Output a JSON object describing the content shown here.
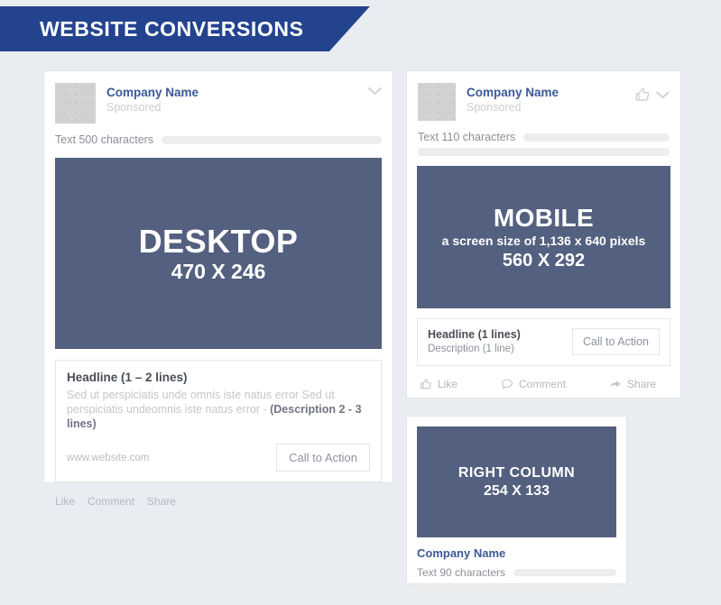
{
  "banner": {
    "title": "WEBSITE CONVERSIONS",
    "bg_color": "#24438f",
    "text_color": "#ffffff"
  },
  "page": {
    "background_color": "#e9ecf0",
    "creative_color": "#53607f",
    "brand_blue": "#3b5998"
  },
  "desktop_card": {
    "company_name": "Company Name",
    "sponsored": "Sponsored",
    "menu_icon": "chevron-down-icon",
    "text_limit_label": "Text 500 characters",
    "creative": {
      "title": "DESKTOP",
      "size": "470 X 246"
    },
    "headline": "Headline (1 – 2 lines)",
    "description_plain": "Sed ut perspiciatis unde omnis iste natus error Sed ut perspiciatis undeomnis iste natus error - ",
    "description_bold": "(Description 2 - 3 lines)",
    "url": "www.website.com",
    "cta_label": "Call to Action",
    "actions": [
      "Like",
      "Comment",
      "Share"
    ]
  },
  "mobile_card": {
    "company_name": "Company Name",
    "sponsored": "Sponsored",
    "like_icon": "thumbs-up-icon",
    "menu_icon": "chevron-down-icon",
    "text_limit_label": "Text 110 characters",
    "creative": {
      "title": "MOBILE",
      "note": "a screen size of 1,136 x 640 pixels",
      "size": "560 X 292"
    },
    "headline": "Headline (1 lines)",
    "description": "Description (1 line)",
    "cta_label": "Call to Action",
    "actions": [
      {
        "label": "Like",
        "icon": "thumbs-up-icon"
      },
      {
        "label": "Comment",
        "icon": "speech-bubble-icon"
      },
      {
        "label": "Share",
        "icon": "share-arrow-icon"
      }
    ]
  },
  "right_column_card": {
    "creative": {
      "title": "RIGHT COLUMN",
      "size": "254 X 133"
    },
    "company_name": "Company Name",
    "text_limit_label": "Text 90 characters"
  }
}
